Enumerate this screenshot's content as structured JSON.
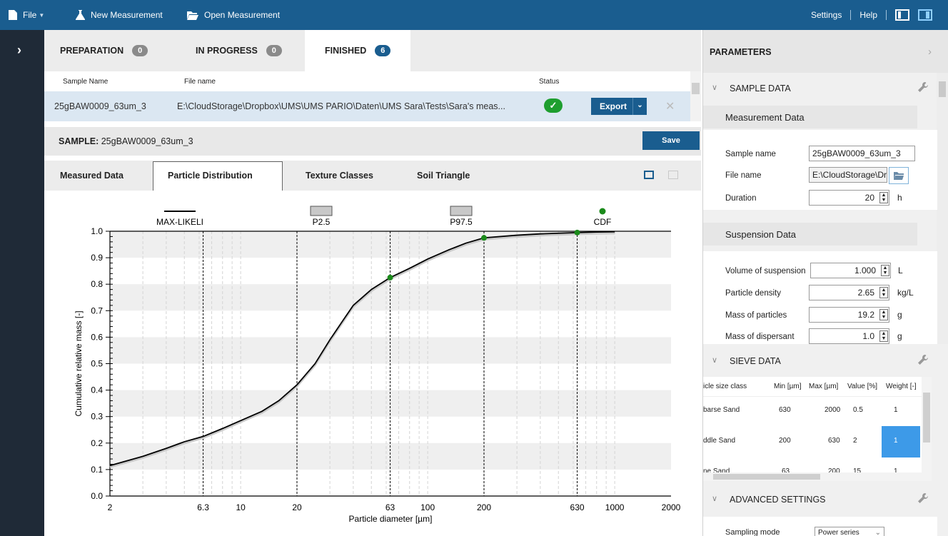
{
  "topbar": {
    "file": "File",
    "new_measurement": "New Measurement",
    "open_measurement": "Open Measurement",
    "settings": "Settings",
    "help": "Help"
  },
  "tabs": [
    {
      "label": "PREPARATION",
      "count": "0"
    },
    {
      "label": "IN PROGRESS",
      "count": "0"
    },
    {
      "label": "FINISHED",
      "count": "6"
    }
  ],
  "table": {
    "headers": {
      "sample_name": "Sample Name",
      "file_name": "File name",
      "status": "Status"
    },
    "row": {
      "sample_name": "25gBAW0009_63um_3",
      "file_name": "E:\\CloudStorage\\Dropbox\\UMS\\UMS PARIO\\Daten\\UMS Sara\\Tests\\Sara's meas...",
      "status_icon": "check-icon",
      "export_label": "Export"
    }
  },
  "sample": {
    "label": "SAMPLE:",
    "name": "25gBAW0009_63um_3",
    "save_label": "Save"
  },
  "subtabs": [
    "Measured Data",
    "Particle Distribution",
    "Texture Classes",
    "Soil Triangle"
  ],
  "chart_data": {
    "type": "line",
    "xlabel": "Particle diameter [µm]",
    "ylabel": "Cumulative relative mass [-]",
    "xscale": "log",
    "xlim": [
      2,
      2000
    ],
    "ylim": [
      0,
      1
    ],
    "xticks": [
      "2",
      "6.3",
      "10",
      "20",
      "63",
      "100",
      "200",
      "630",
      "1000",
      "2000"
    ],
    "yticks": [
      "0.0",
      "0.1",
      "0.2",
      "0.3",
      "0.4",
      "0.5",
      "0.6",
      "0.7",
      "0.8",
      "0.9",
      "1.0"
    ],
    "legend": [
      "MAX-LIKELI",
      "P2.5",
      "P97.5",
      "CDF"
    ],
    "series": [
      {
        "name": "MAX-LIKELI",
        "x": [
          2,
          3,
          4,
          5,
          6.3,
          8,
          10,
          13,
          16,
          20,
          25,
          30,
          35,
          40,
          50,
          63,
          80,
          100,
          130,
          160,
          200,
          300,
          400,
          630,
          800,
          1000
        ],
        "y": [
          0.115,
          0.15,
          0.18,
          0.205,
          0.225,
          0.255,
          0.285,
          0.32,
          0.36,
          0.42,
          0.5,
          0.59,
          0.66,
          0.72,
          0.78,
          0.825,
          0.86,
          0.895,
          0.93,
          0.955,
          0.975,
          0.985,
          0.99,
          0.995,
          0.997,
          0.998
        ]
      },
      {
        "name": "CDF",
        "x": [
          63,
          200,
          630
        ],
        "y": [
          0.825,
          0.975,
          0.995
        ]
      }
    ],
    "colors": {
      "line": "#000000",
      "band": "#c8c8c8",
      "cdf": "#1a8a1a"
    }
  },
  "parameters": {
    "title": "PARAMETERS",
    "sample_data": {
      "title": "SAMPLE DATA",
      "measurement_data": "Measurement Data",
      "sample_name_label": "Sample name",
      "sample_name_value": "25gBAW0009_63um_3",
      "file_name_label": "File name",
      "file_name_value": "E:\\CloudStorage\\Dro",
      "duration_label": "Duration",
      "duration_value": "20",
      "duration_unit": "h",
      "suspension_data": "Suspension Data",
      "volume_label": "Volume of suspension",
      "volume_value": "1.000",
      "volume_unit": "L",
      "density_label": "Particle density",
      "density_value": "2.65",
      "density_unit": "kg/L",
      "mass_particles_label": "Mass of particles",
      "mass_particles_value": "19.2",
      "mass_particles_unit": "g",
      "mass_dispersant_label": "Mass of dispersant",
      "mass_dispersant_value": "1.0",
      "mass_dispersant_unit": "g"
    },
    "sieve_data": {
      "title": "SIEVE DATA",
      "headers": [
        "icle size class",
        "Min [µm]",
        "Max [µm]",
        "Value [%]",
        "Weight [-]"
      ],
      "rows": [
        [
          "barse Sand",
          "630",
          "2000",
          "0.5",
          "1"
        ],
        [
          "ddle Sand",
          "200",
          "630",
          "2",
          "1"
        ],
        [
          "ne Sand",
          "63",
          "200",
          "15",
          "1"
        ]
      ]
    },
    "advanced": {
      "title": "ADVANCED SETTINGS",
      "sampling_label": "Sampling mode",
      "sampling_value": "Power series"
    }
  }
}
